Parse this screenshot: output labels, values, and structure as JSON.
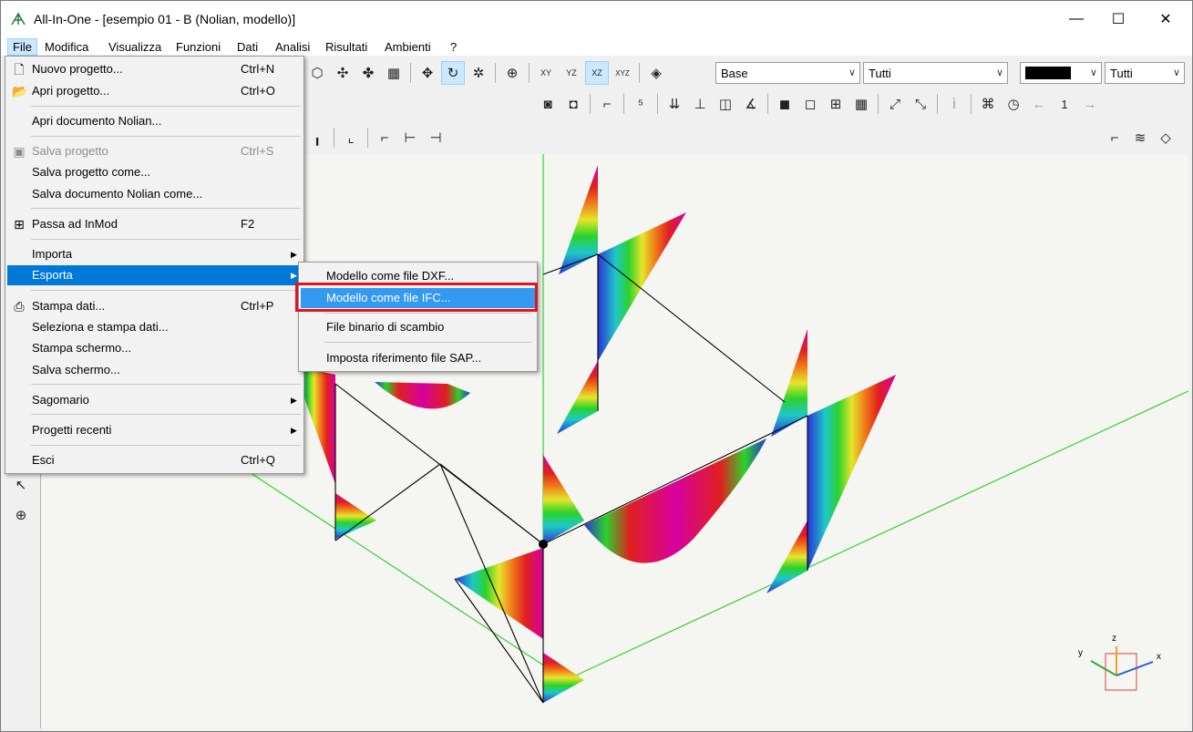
{
  "window": {
    "title": "All-In-One - [esempio 01 - B (Nolian, modello)]",
    "controls": {
      "minimize": "—",
      "maximize": "☐",
      "close": "✕"
    }
  },
  "menubar": [
    "File",
    "Modifica",
    "Visualizza",
    "Funzioni",
    "Dati",
    "Analisi",
    "Risultati",
    "Ambienti",
    "?"
  ],
  "toolbar": {
    "combo_base": "Base",
    "combo_tutti_1": "Tutti",
    "combo_tutti_2": "Tutti",
    "color_swatch": "#000000",
    "view_buttons": [
      "XY",
      "YZ",
      "XZ",
      "XYZ"
    ],
    "counter": "1"
  },
  "file_menu": [
    {
      "label": "Nuovo progetto...",
      "shortcut": "Ctrl+N",
      "icon": "new-document-icon"
    },
    {
      "label": "Apri progetto...",
      "shortcut": "Ctrl+O",
      "icon": "open-folder-icon"
    },
    {
      "label": "Apri documento Nolian..."
    },
    {
      "label": "Salva progetto",
      "shortcut": "Ctrl+S",
      "icon": "save-icon",
      "disabled": true
    },
    {
      "label": "Salva progetto come..."
    },
    {
      "label": "Salva documento Nolian come..."
    },
    {
      "label": "Passa ad InMod",
      "shortcut": "F2",
      "icon": "grid-icon"
    },
    {
      "label": "Importa",
      "submenu": true
    },
    {
      "label": "Esporta",
      "submenu": true,
      "highlighted": true
    },
    {
      "label": "Stampa dati...",
      "shortcut": "Ctrl+P",
      "icon": "printer-icon"
    },
    {
      "label": "Seleziona e stampa dati..."
    },
    {
      "label": "Stampa schermo..."
    },
    {
      "label": "Salva schermo..."
    },
    {
      "label": "Sagomario",
      "submenu": true
    },
    {
      "label": "Progetti recenti",
      "submenu": true
    },
    {
      "label": "Esci",
      "shortcut": "Ctrl+Q"
    }
  ],
  "export_submenu": [
    {
      "label": "Modello come file DXF..."
    },
    {
      "label": "Modello come file IFC...",
      "highlighted": true
    },
    {
      "label": "File binario di scambio"
    },
    {
      "label": "Imposta riferimento file SAP..."
    }
  ],
  "axes": {
    "x": "x",
    "y": "y",
    "z": "z"
  },
  "colors": {
    "highlight": "#0078d7",
    "callout": "#e0141e",
    "ground_lines": "#32d232"
  }
}
